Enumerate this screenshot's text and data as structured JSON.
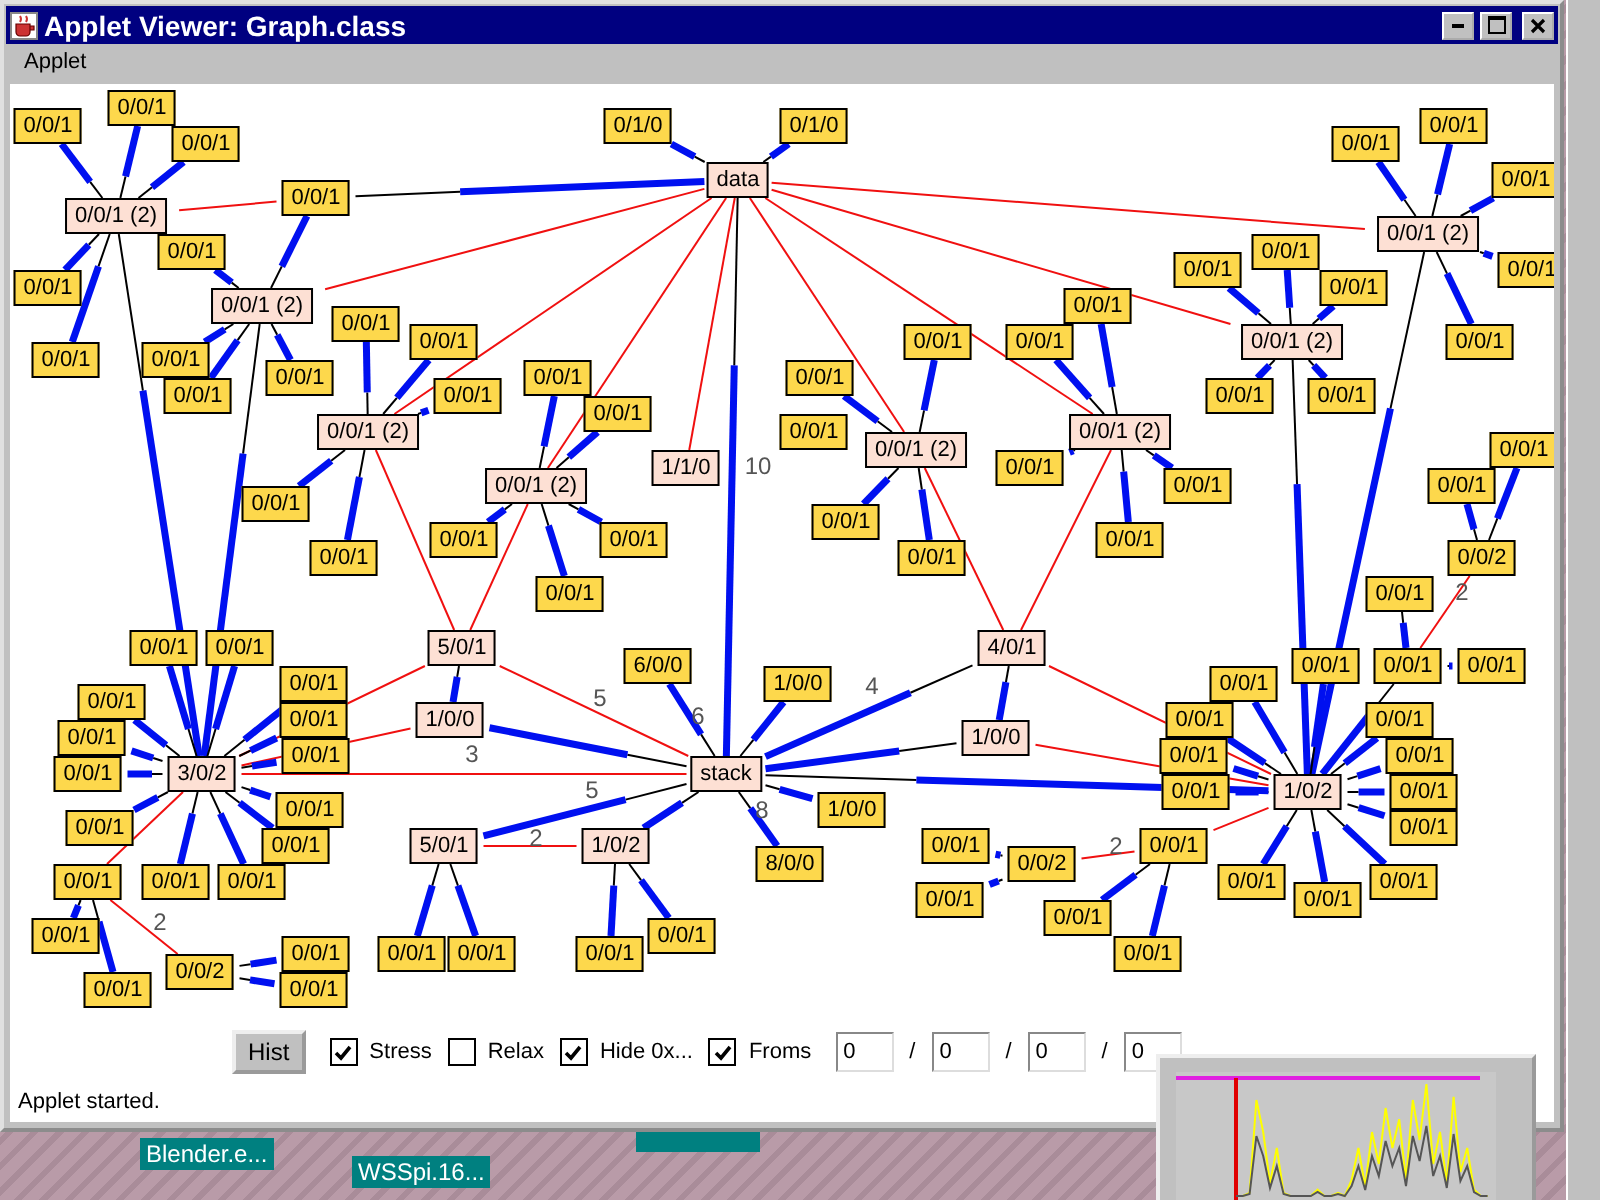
{
  "window": {
    "title": "Applet Viewer: Graph.class",
    "menu": [
      "Applet"
    ]
  },
  "graph": {
    "nodes": [
      {
        "label": "0/0/1",
        "kind": "leaf"
      },
      {
        "label": "0/0/1",
        "kind": "leaf"
      },
      {
        "label": "0/1/0",
        "kind": "leaf"
      },
      {
        "label": "0/1/0",
        "kind": "leaf"
      },
      {
        "label": "0/0/1",
        "kind": "leaf"
      },
      {
        "label": "0/0/1",
        "kind": "leaf"
      },
      {
        "label": "0/0/1",
        "kind": "leaf"
      },
      {
        "label": "data",
        "kind": "hub"
      },
      {
        "label": "0/0/1",
        "kind": "leaf"
      },
      {
        "label": "0/0/1",
        "kind": "leaf"
      },
      {
        "label": "0/0/1 (2)",
        "kind": "hub"
      },
      {
        "label": "0/0/1 (2)",
        "kind": "hub"
      },
      {
        "label": "0/0/1",
        "kind": "leaf"
      },
      {
        "label": "0/0/1",
        "kind": "leaf"
      },
      {
        "label": "0/0/1",
        "kind": "leaf"
      },
      {
        "label": "0/0/1",
        "kind": "leaf"
      },
      {
        "label": "0/0/1",
        "kind": "leaf"
      },
      {
        "label": "0/0/1",
        "kind": "leaf"
      },
      {
        "label": "0/0/1 (2)",
        "kind": "hub"
      },
      {
        "label": "0/0/1",
        "kind": "leaf"
      },
      {
        "label": "0/0/1",
        "kind": "leaf"
      },
      {
        "label": "0/0/1",
        "kind": "leaf"
      },
      {
        "label": "0/0/1",
        "kind": "leaf"
      },
      {
        "label": "0/0/1",
        "kind": "leaf"
      },
      {
        "label": "0/0/1 (2)",
        "kind": "hub"
      },
      {
        "label": "0/0/1",
        "kind": "leaf"
      },
      {
        "label": "0/0/1",
        "kind": "leaf"
      },
      {
        "label": "0/0/1",
        "kind": "leaf"
      },
      {
        "label": "0/0/1",
        "kind": "leaf"
      },
      {
        "label": "0/0/1",
        "kind": "leaf"
      },
      {
        "label": "0/0/1",
        "kind": "leaf"
      },
      {
        "label": "0/0/1",
        "kind": "leaf"
      },
      {
        "label": "0/0/1",
        "kind": "leaf"
      },
      {
        "label": "0/0/1",
        "kind": "leaf"
      },
      {
        "label": "0/0/1",
        "kind": "leaf"
      },
      {
        "label": "0/0/1",
        "kind": "leaf"
      },
      {
        "label": "0/0/1 (2)",
        "kind": "hub"
      },
      {
        "label": "0/0/1",
        "kind": "leaf"
      },
      {
        "label": "0/0/1 (2)",
        "kind": "hub"
      },
      {
        "label": "0/0/1 (2)",
        "kind": "hub"
      },
      {
        "label": "0/0/1",
        "kind": "leaf"
      },
      {
        "label": "1/1/0",
        "kind": "hub"
      },
      {
        "label": "0/0/1",
        "kind": "leaf"
      },
      {
        "label": "0/0/1 (2)",
        "kind": "hub"
      },
      {
        "label": "0/0/1",
        "kind": "leaf"
      },
      {
        "label": "0/0/1",
        "kind": "leaf"
      },
      {
        "label": "0/0/1",
        "kind": "leaf"
      },
      {
        "label": "0/0/1",
        "kind": "leaf"
      },
      {
        "label": "0/0/1",
        "kind": "leaf"
      },
      {
        "label": "0/0/1",
        "kind": "leaf"
      },
      {
        "label": "0/0/1",
        "kind": "leaf"
      },
      {
        "label": "0/0/1",
        "kind": "leaf"
      },
      {
        "label": "0/0/1",
        "kind": "leaf"
      },
      {
        "label": "0/0/2",
        "kind": "leaf"
      },
      {
        "label": "0/0/1",
        "kind": "leaf"
      },
      {
        "label": "0/0/1",
        "kind": "leaf"
      },
      {
        "label": "0/0/1",
        "kind": "leaf"
      },
      {
        "label": "0/0/1",
        "kind": "leaf"
      },
      {
        "label": "5/0/1",
        "kind": "hub"
      },
      {
        "label": "4/0/1",
        "kind": "hub"
      },
      {
        "label": "6/0/0",
        "kind": "leaf"
      },
      {
        "label": "0/0/1",
        "kind": "leaf"
      },
      {
        "label": "0/0/1",
        "kind": "leaf"
      },
      {
        "label": "0/0/1",
        "kind": "leaf"
      },
      {
        "label": "0/0/1",
        "kind": "leaf"
      },
      {
        "label": "1/0/0",
        "kind": "leaf"
      },
      {
        "label": "0/0/1",
        "kind": "leaf"
      },
      {
        "label": "0/0/1",
        "kind": "leaf"
      },
      {
        "label": "0/0/1",
        "kind": "leaf"
      },
      {
        "label": "1/0/0",
        "kind": "hub"
      },
      {
        "label": "0/0/1",
        "kind": "leaf"
      },
      {
        "label": "0/0/1",
        "kind": "leaf"
      },
      {
        "label": "0/0/1",
        "kind": "leaf"
      },
      {
        "label": "1/0/0",
        "kind": "hub"
      },
      {
        "label": "0/0/1",
        "kind": "leaf"
      },
      {
        "label": "0/0/1",
        "kind": "leaf"
      },
      {
        "label": "0/0/1",
        "kind": "leaf"
      },
      {
        "label": "0/0/1",
        "kind": "leaf"
      },
      {
        "label": "3/0/2",
        "kind": "hub"
      },
      {
        "label": "stack",
        "kind": "hub"
      },
      {
        "label": "0/0/1",
        "kind": "leaf"
      },
      {
        "label": "1/0/2",
        "kind": "hub"
      },
      {
        "label": "0/0/1",
        "kind": "leaf"
      },
      {
        "label": "0/0/1",
        "kind": "leaf"
      },
      {
        "label": "1/0/0",
        "kind": "leaf"
      },
      {
        "label": "0/0/1",
        "kind": "leaf"
      },
      {
        "label": "0/0/1",
        "kind": "leaf"
      },
      {
        "label": "0/0/1",
        "kind": "leaf"
      },
      {
        "label": "5/0/1",
        "kind": "hub"
      },
      {
        "label": "1/0/2",
        "kind": "hub"
      },
      {
        "label": "0/0/1",
        "kind": "leaf"
      },
      {
        "label": "0/0/1",
        "kind": "leaf"
      },
      {
        "label": "8/0/0",
        "kind": "leaf"
      },
      {
        "label": "0/0/2",
        "kind": "leaf"
      },
      {
        "label": "0/0/1",
        "kind": "leaf"
      },
      {
        "label": "0/0/1",
        "kind": "leaf"
      },
      {
        "label": "0/0/1",
        "kind": "leaf"
      },
      {
        "label": "0/0/1",
        "kind": "leaf"
      },
      {
        "label": "0/0/1",
        "kind": "leaf"
      },
      {
        "label": "0/0/1",
        "kind": "leaf"
      },
      {
        "label": "0/0/1",
        "kind": "leaf"
      },
      {
        "label": "0/0/1",
        "kind": "leaf"
      },
      {
        "label": "0/0/1",
        "kind": "leaf"
      },
      {
        "label": "0/0/1",
        "kind": "leaf"
      },
      {
        "label": "0/0/1",
        "kind": "leaf"
      },
      {
        "label": "0/0/1",
        "kind": "leaf"
      },
      {
        "label": "0/0/1",
        "kind": "leaf"
      },
      {
        "label": "0/0/1",
        "kind": "leaf"
      },
      {
        "label": "0/0/1",
        "kind": "leaf"
      },
      {
        "label": "0/0/2",
        "kind": "leaf"
      },
      {
        "label": "0/0/1",
        "kind": "leaf"
      },
      {
        "label": "0/0/1",
        "kind": "leaf"
      }
    ],
    "edge_labels": [
      "10",
      "2",
      "2",
      "4",
      "6",
      "8",
      "5",
      "3",
      "5",
      "2",
      "2"
    ]
  },
  "controls": {
    "button": "Hist",
    "checkboxes": [
      {
        "label": "Stress",
        "checked": true
      },
      {
        "label": "Relax",
        "checked": false
      },
      {
        "label": "Hide 0x...",
        "checked": true
      },
      {
        "label": "Froms",
        "checked": true
      }
    ],
    "fields": [
      {
        "value": "0"
      },
      {
        "value": "0"
      },
      {
        "value": "0"
      },
      {
        "value": "0"
      }
    ],
    "separators": [
      "/",
      "/",
      "/"
    ]
  },
  "status_bar": "Applet started.",
  "desktop": {
    "icons": [
      {
        "label": "Blender.e..."
      },
      {
        "label": "WSSpi.16..."
      }
    ]
  }
}
